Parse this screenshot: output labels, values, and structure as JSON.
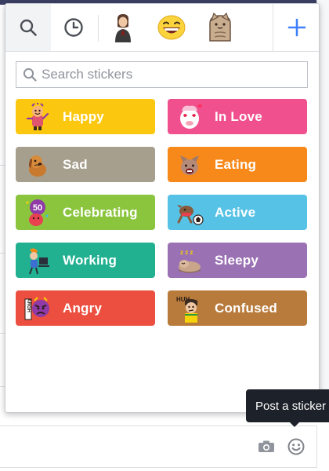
{
  "search": {
    "placeholder": "Search stickers"
  },
  "tabs": [
    {
      "name": "search-tab",
      "icon": "search-icon",
      "active": true
    },
    {
      "name": "recent-tab",
      "icon": "clock-icon",
      "active": false
    },
    {
      "name": "sticker-pack-tab",
      "icon": "pack-person-icon",
      "active": false
    },
    {
      "name": "sticker-pack-tab",
      "icon": "pack-smiley-icon",
      "active": false
    },
    {
      "name": "sticker-pack-tab",
      "icon": "pack-cat-icon",
      "active": false
    },
    {
      "name": "add-pack-tab",
      "icon": "plus-icon",
      "active": false
    }
  ],
  "categories": [
    {
      "label": "Happy",
      "color": "#fcc70f",
      "icon": "happy-sticker-icon"
    },
    {
      "label": "In Love",
      "color": "#f0508d",
      "icon": "in-love-sticker-icon"
    },
    {
      "label": "Sad",
      "color": "#a69f8d",
      "icon": "sad-sticker-icon"
    },
    {
      "label": "Eating",
      "color": "#f7891b",
      "icon": "eating-sticker-icon"
    },
    {
      "label": "Celebrating",
      "color": "#8bc53e",
      "icon": "celebrating-sticker-icon"
    },
    {
      "label": "Active",
      "color": "#56c2e6",
      "icon": "active-sticker-icon"
    },
    {
      "label": "Working",
      "color": "#21b190",
      "icon": "working-sticker-icon"
    },
    {
      "label": "Sleepy",
      "color": "#9a71b3",
      "icon": "sleepy-sticker-icon"
    },
    {
      "label": "Angry",
      "color": "#ec4f40",
      "icon": "angry-sticker-icon"
    },
    {
      "label": "Confused",
      "color": "#b87b3c",
      "icon": "confused-sticker-icon"
    }
  ],
  "celebrating_badge": "50",
  "angry_badge": "ARGH",
  "confused_badge": "HUH",
  "tooltip": {
    "text": "Post a sticker"
  },
  "colors": {
    "add_accent": "#4080ff",
    "tooltip_bg": "#1d2129"
  }
}
